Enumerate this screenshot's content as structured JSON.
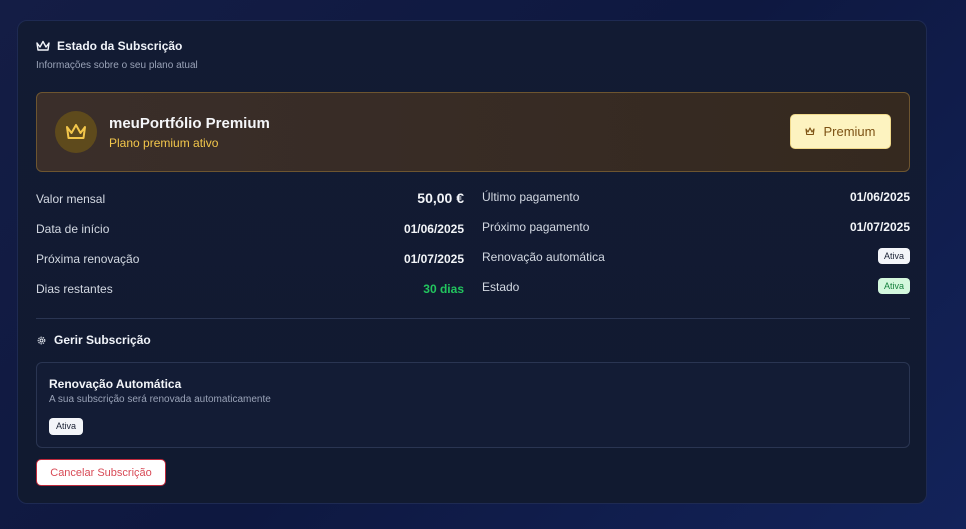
{
  "header": {
    "icon": "crown-icon",
    "title": "Estado da Subscrição",
    "subtitle": "Informações sobre o seu plano atual"
  },
  "plan": {
    "icon": "crown-icon",
    "name": "meuPortfólio Premium",
    "status": "Plano premium ativo",
    "badge_label": "Premium",
    "badge_icon": "crown-icon",
    "accent_color": "#f3c74b"
  },
  "details_left": [
    {
      "label": "Valor mensal",
      "value": "50,00 €"
    },
    {
      "label": "Data de início",
      "value": "01/06/2025"
    },
    {
      "label": "Próxima renovação",
      "value": "01/07/2025"
    },
    {
      "label": "Dias restantes",
      "value": "30 dias"
    }
  ],
  "details_right": [
    {
      "label": "Último pagamento",
      "value": "01/06/2025"
    },
    {
      "label": "Próximo pagamento",
      "value": "01/07/2025"
    },
    {
      "label": "Renovação automática",
      "value": "Ativa"
    },
    {
      "label": "Estado",
      "value": "Ativa"
    }
  ],
  "manage": {
    "icon": "gear-icon",
    "title": "Gerir Subscrição",
    "auto_title": "Renovação Automática",
    "auto_subtitle": "A sua subscrição será renovada automaticamente",
    "auto_badge": "Ativa",
    "cancel_label": "Cancelar Subscrição"
  },
  "colors": {
    "positive": "#22c55e",
    "danger": "#c0293b"
  }
}
